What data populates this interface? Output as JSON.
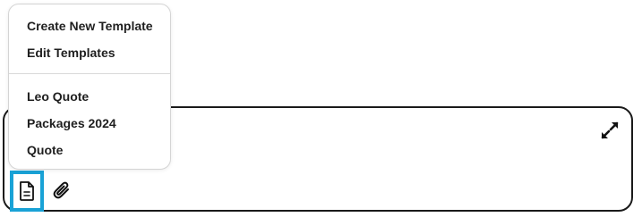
{
  "template_menu": {
    "actions": [
      {
        "label": "Create New Template"
      },
      {
        "label": "Edit Templates"
      }
    ],
    "templates": [
      {
        "label": "Leo Quote"
      },
      {
        "label": "Packages 2024"
      },
      {
        "label": "Quote"
      }
    ]
  },
  "composer": {
    "toolbar": {
      "template_icon": "document-icon",
      "attach_icon": "paperclip-icon",
      "expand_icon": "expand-icon"
    }
  },
  "colors": {
    "focus_outline": "#19a2d6",
    "border": "#1a1a1a",
    "text": "#1f1f1f"
  }
}
